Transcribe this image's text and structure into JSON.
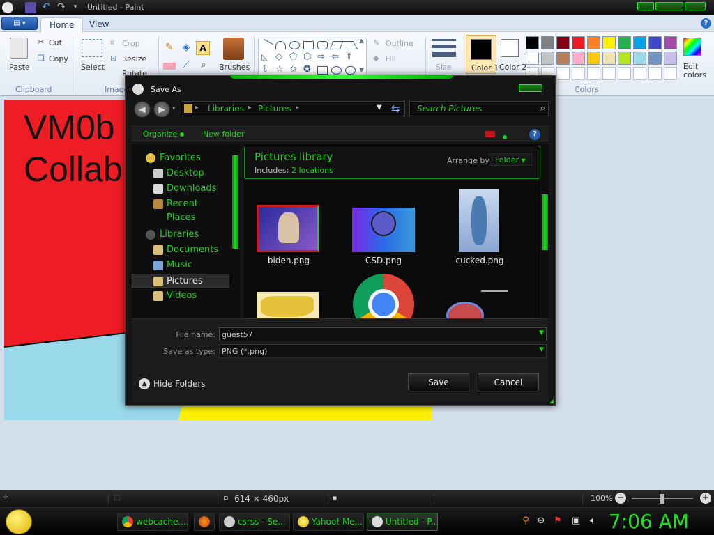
{
  "window": {
    "title": "Untitled - Paint"
  },
  "ribbon": {
    "tabs": [
      "Home",
      "View"
    ],
    "clipboard": {
      "paste": "Paste",
      "cut": "Cut",
      "copy": "Copy",
      "group": "Clipboard"
    },
    "image": {
      "select": "Select",
      "crop": "Crop",
      "resize": "Resize",
      "rotate": "Rotate",
      "group": "Image"
    },
    "tools": {
      "brushes": "Brushes"
    },
    "shapes": {
      "outline": "Outline",
      "fill": "Fill"
    },
    "size": "Size",
    "color1": "Color 1",
    "color2": "Color 2",
    "edit_colors": "Edit colors",
    "colors_group": "Colors",
    "palette": [
      "#000000",
      "#7f7f7f",
      "#880015",
      "#ed1c24",
      "#ff7f27",
      "#fff200",
      "#22b14c",
      "#00a2e8",
      "#3f48cc",
      "#a349a4",
      "#ffffff",
      "#c3c3c3",
      "#b97a57",
      "#ffaec9",
      "#ffc90e",
      "#efe4b0",
      "#b5e61d",
      "#99d9ea",
      "#7092be",
      "#c8bfe7"
    ]
  },
  "canvas": {
    "text_line1": "VM0b",
    "text_line2": "Collab"
  },
  "statusbar": {
    "dimensions": "614 × 460px",
    "zoom": "100%"
  },
  "dialog": {
    "title": "Save As",
    "breadcrumb": [
      "Libraries",
      "Pictures"
    ],
    "search_placeholder": "Search Pictures",
    "organize": "Organize",
    "new_folder": "New folder",
    "nav": {
      "favorites": "Favorites",
      "desktop": "Desktop",
      "downloads": "Downloads",
      "recent": "Recent Places",
      "libraries": "Libraries",
      "documents": "Documents",
      "music": "Music",
      "pictures": "Pictures",
      "videos": "Videos"
    },
    "library": {
      "title": "Pictures library",
      "includes_label": "Includes:",
      "includes_value": "2 locations",
      "arrange_label": "Arrange by:",
      "arrange_value": "Folder"
    },
    "files": [
      "biden.png",
      "CSD.png",
      "cucked.png"
    ],
    "file_name_label": "File name:",
    "file_name_value": "guest57",
    "save_type_label": "Save as type:",
    "save_type_value": "PNG (*.png)",
    "hide_folders": "Hide Folders",
    "save": "Save",
    "cancel": "Cancel"
  },
  "taskbar": {
    "tasks": [
      "webcache....",
      "csrss - Se...",
      "Yahoo! Me...",
      "Untitled - P..."
    ],
    "clock": "7:06 AM"
  },
  "colors": {
    "accent_green": "#1fd31f",
    "canvas_red": "#ee1c24",
    "canvas_lightblue": "#99d9ea",
    "canvas_yellow": "#fff200"
  }
}
